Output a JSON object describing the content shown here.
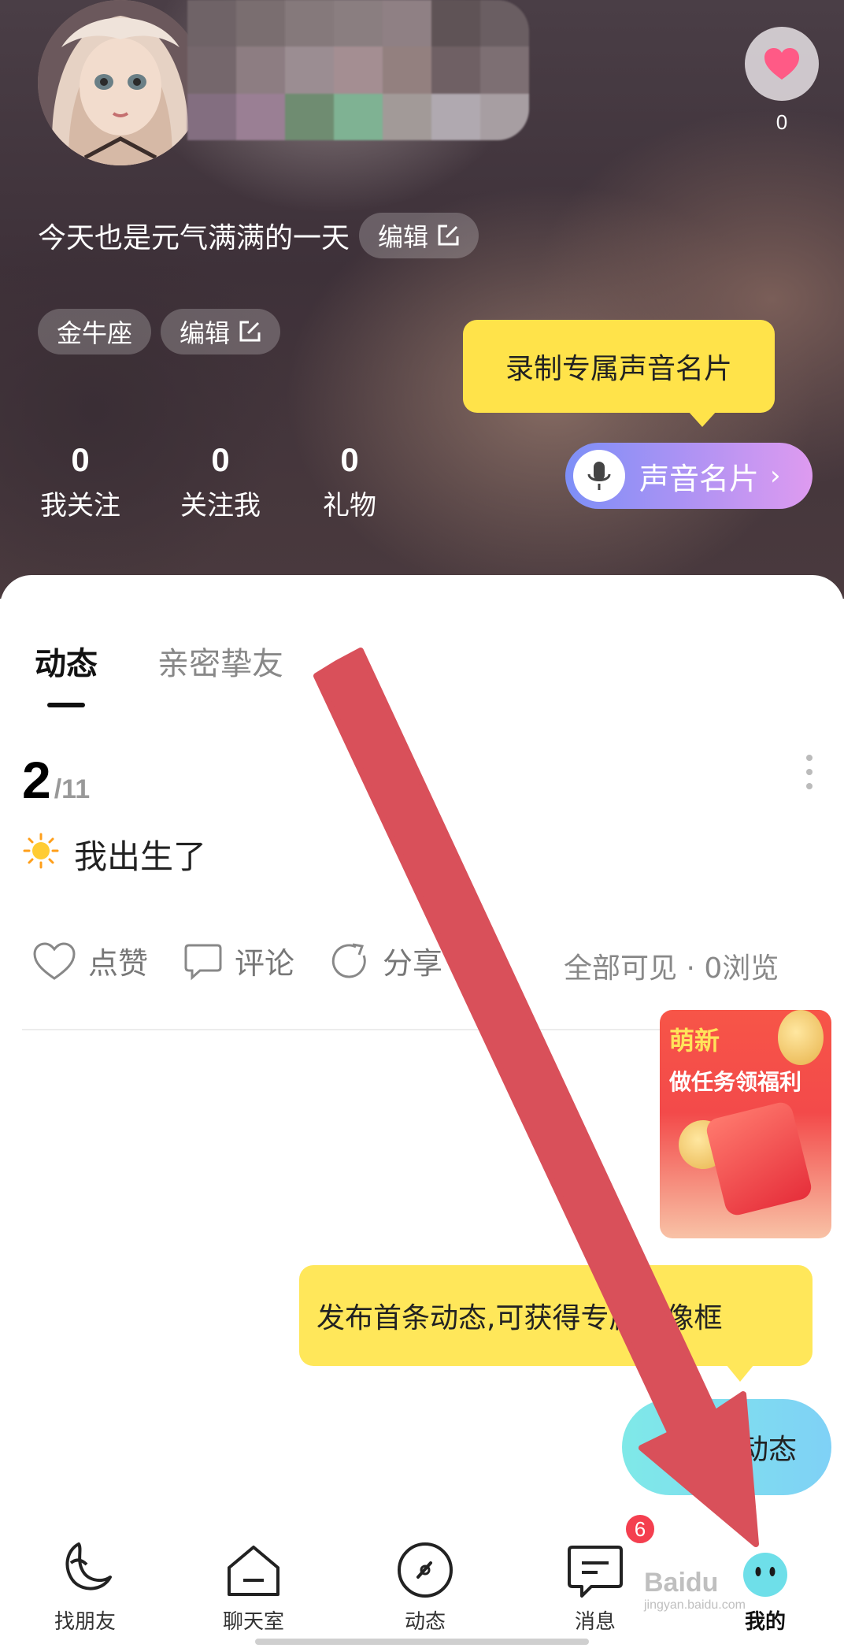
{
  "profile": {
    "bio": "今天也是元气满满的一天",
    "bio_edit": "编辑",
    "tag_zodiac": "金牛座",
    "tag_edit": "编辑",
    "likes": "0"
  },
  "voice_card": {
    "tooltip": "录制专属声音名片",
    "button": "声音名片",
    "chevron": "›"
  },
  "stats": [
    {
      "value": "0",
      "label": "我关注"
    },
    {
      "value": "0",
      "label": "关注我"
    },
    {
      "value": "0",
      "label": "礼物"
    }
  ],
  "tabs": [
    {
      "label": "动态",
      "active": true
    },
    {
      "label": "亲密挚友",
      "active": false
    }
  ],
  "post": {
    "day": "2",
    "month": "/11",
    "emoji": "☀️",
    "text": "我出生了",
    "actions": {
      "like": "点赞",
      "comment": "评论",
      "share": "分享"
    },
    "visibility": "全部可见 · 0浏览"
  },
  "promo": {
    "line1": "萌新",
    "line2": "做任务领福利"
  },
  "publish": {
    "tip": "发布首条动态,可获得专属头像框",
    "button": "动态"
  },
  "nav": [
    {
      "label": "找朋友",
      "icon": "moon-icon"
    },
    {
      "label": "聊天室",
      "icon": "house-icon"
    },
    {
      "label": "动态",
      "icon": "compass-icon"
    },
    {
      "label": "消息",
      "icon": "message-icon",
      "badge": "6"
    },
    {
      "label": "我的",
      "icon": "smiley-icon",
      "active": true
    }
  ],
  "watermark": {
    "main": "Baidu",
    "sub": "jingyan.baidu.com"
  },
  "colors": {
    "accent_yellow": "#ffe34a",
    "arrow_red": "#d9505a",
    "voice_gradient_start": "#7d8ff7",
    "voice_gradient_end": "#de9bf0",
    "publish_gradient": "#7fe9e8",
    "badge_red": "#f43f4f"
  }
}
